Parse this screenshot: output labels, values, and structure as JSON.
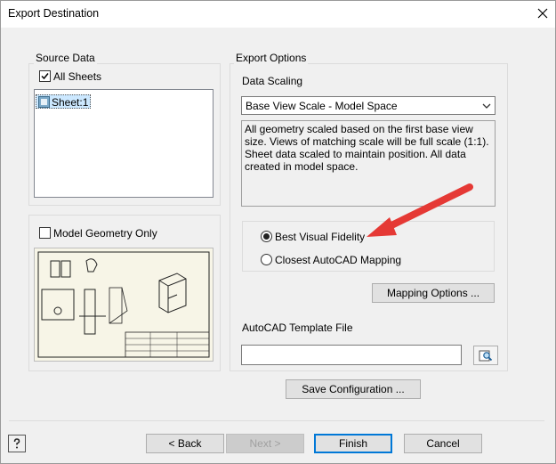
{
  "window": {
    "title": "Export Destination"
  },
  "source": {
    "group_label": "Source Data",
    "all_sheets_label": "All Sheets",
    "all_sheets_checked": true,
    "sheets": [
      "Sheet:1"
    ],
    "model_geometry_label": "Model Geometry Only",
    "model_geometry_checked": false
  },
  "options": {
    "group_label": "Export Options",
    "data_scaling_label": "Data Scaling",
    "data_scaling_value": "Base View Scale - Model Space",
    "description": "All geometry scaled based on the first base view size. Views of matching scale will be full scale (1:1). Sheet data scaled to maintain position. All data created in model space.",
    "radio_best": "Best Visual Fidelity",
    "radio_closest": "Closest AutoCAD Mapping",
    "selected": "best",
    "mapping_button": "Mapping Options ...",
    "template_label": "AutoCAD Template File",
    "template_value": ""
  },
  "save_config": "Save Configuration ...",
  "footer": {
    "back": "< Back",
    "next": "Next >",
    "finish": "Finish",
    "cancel": "Cancel",
    "help_icon": "help-icon"
  },
  "colors": {
    "accent": "#0078d7",
    "selection": "#cce8ff",
    "arrow": "#e53935",
    "preview_bg": "#f7f5e7"
  }
}
